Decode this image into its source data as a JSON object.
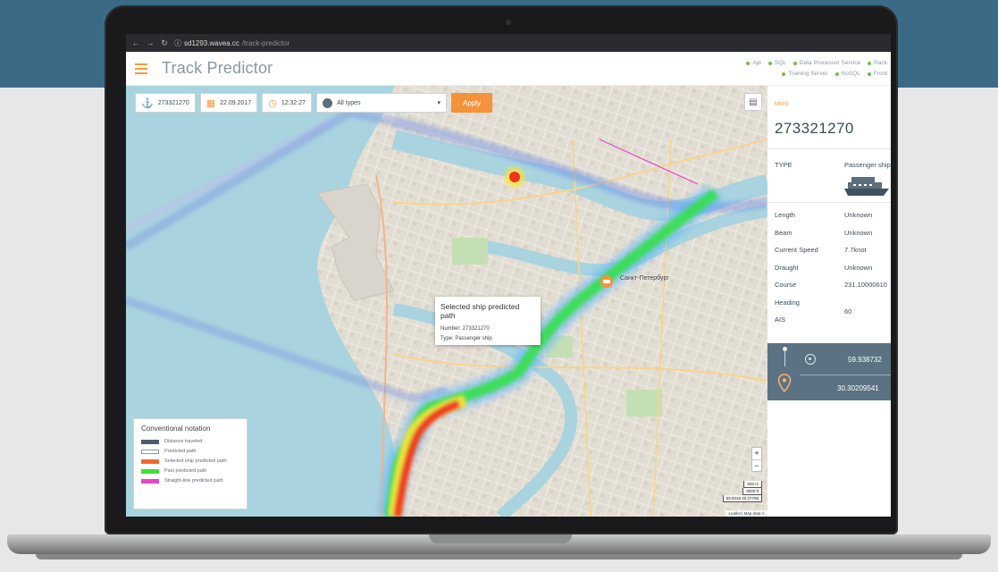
{
  "browser": {
    "url_host": "sd1293.wavea.cc",
    "url_path": "/track-predictor",
    "info_icon": "info-icon"
  },
  "app": {
    "title": "Track Predictor",
    "status_row1": [
      "Api",
      "SQL",
      "Data Processor Service",
      "Rack"
    ],
    "status_row2": [
      "Training Server",
      "NoSQL",
      "Front"
    ],
    "status_color": "#6cc04a",
    "accent": "#f39a3b"
  },
  "toolbar": {
    "mmsi_value": "273321270",
    "date_value": "22.09.2017",
    "time_value": "12:32:27",
    "type_value": "All types",
    "apply_label": "Apply"
  },
  "popup": {
    "title": "Selected ship predicted path",
    "number": "Number: 273321270",
    "type": "Type: Passenger ship"
  },
  "map_labels": {
    "city": "Санкт-Петербург"
  },
  "legend": {
    "title": "Conventional notation",
    "items": [
      {
        "label": "Distance traveled",
        "color": "#4a5f6c"
      },
      {
        "label": "Predicted path",
        "color": "#ffffff"
      },
      {
        "label": "Selected ship predicted path",
        "color": "#f2692c"
      },
      {
        "label": "Past predicted path",
        "color": "#3ee03a"
      },
      {
        "label": "Straight-line predicted path",
        "color": "#e845c9"
      }
    ]
  },
  "zoom": {
    "in": "+",
    "out": "−"
  },
  "scale": {
    "line1": "500 m",
    "line2": "3000 ft",
    "coords": "59.9318  30.27798"
  },
  "attribution": "Leaflet | Map data ©",
  "panel": {
    "mmsi_label": "MMSI",
    "mmsi_value": "273321270",
    "type_label": "TYPE",
    "type_value": "Passenger ship",
    "props": [
      {
        "label": "Length",
        "value": "Unknown"
      },
      {
        "label": "Beam",
        "value": "Unknown"
      },
      {
        "label": "Current Speed",
        "value": "7.7knot"
      },
      {
        "label": "Draught",
        "value": "Unknown"
      },
      {
        "label": "Course",
        "value": "231.10000610"
      },
      {
        "label": "Heading",
        "value": "60"
      },
      {
        "label": "AIS",
        "value": ""
      }
    ],
    "lat": "59.938732",
    "lon": "30.30209541"
  }
}
